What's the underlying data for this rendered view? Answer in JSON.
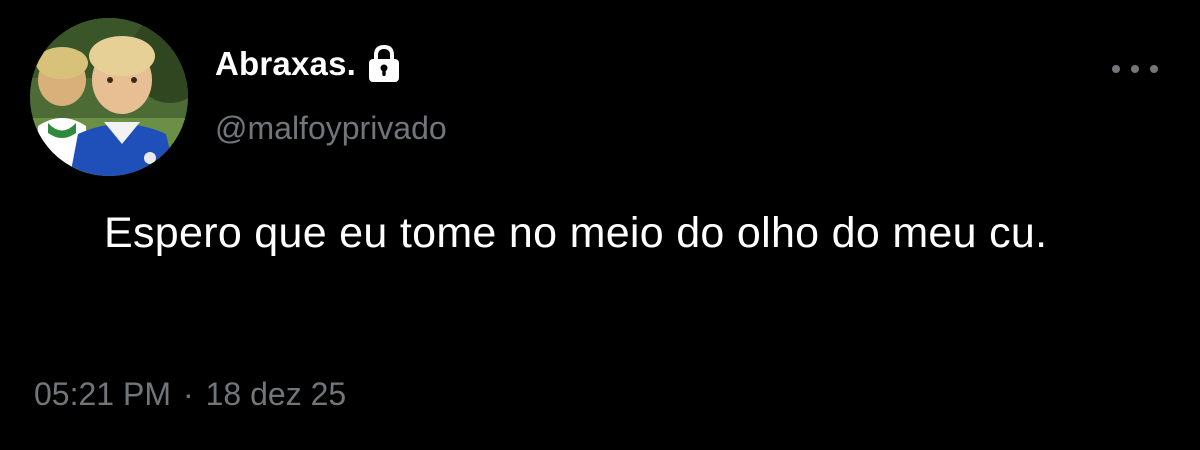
{
  "user": {
    "display_name": "Abraxas.",
    "handle": "@malfoyprivado",
    "avatar_icon": "profile-photo",
    "protected_icon": "lock-icon"
  },
  "tweet": {
    "text": "Espero que eu tome no meio do olho do meu cu.",
    "time": "05:21 PM",
    "separator": "·",
    "date": "18 dez 25"
  },
  "actions": {
    "more_icon": "more-horizontal-icon"
  },
  "colors": {
    "background": "#000000",
    "primary_text": "#ffffff",
    "secondary_text": "#71767b"
  }
}
